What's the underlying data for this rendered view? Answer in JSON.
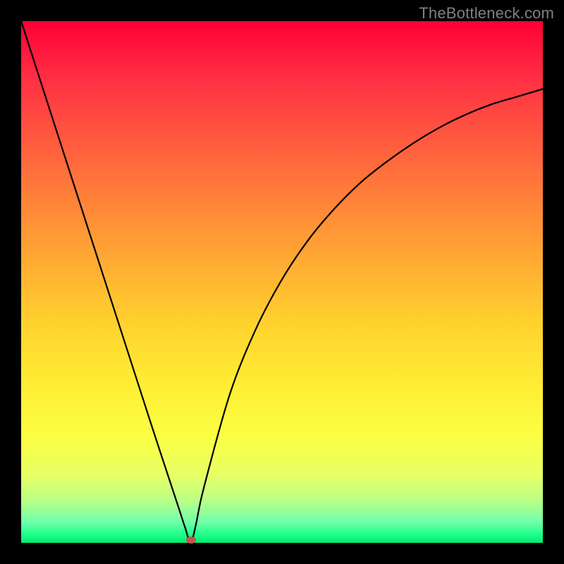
{
  "watermark_text": "TheBottleneck.com",
  "marker": {
    "x_frac": 0.325,
    "y_frac": 0.995,
    "color": "#cc4f4f"
  },
  "chart_data": {
    "type": "line",
    "title": "",
    "xlabel": "",
    "ylabel": "",
    "xlim": [
      0,
      1
    ],
    "ylim": [
      0,
      1
    ],
    "series": [
      {
        "name": "curve",
        "x": [
          0.0,
          0.05,
          0.1,
          0.15,
          0.2,
          0.25,
          0.3,
          0.315,
          0.325,
          0.335,
          0.35,
          0.4,
          0.45,
          0.5,
          0.55,
          0.6,
          0.65,
          0.7,
          0.75,
          0.8,
          0.85,
          0.9,
          0.95,
          1.0
        ],
        "y": [
          1.0,
          0.845,
          0.69,
          0.535,
          0.38,
          0.225,
          0.073,
          0.027,
          0.0,
          0.035,
          0.105,
          0.285,
          0.41,
          0.505,
          0.58,
          0.64,
          0.69,
          0.73,
          0.765,
          0.795,
          0.82,
          0.84,
          0.855,
          0.87
        ]
      }
    ],
    "gradient_stops": [
      {
        "pos": 0.0,
        "color": "#ff0033"
      },
      {
        "pos": 0.2,
        "color": "#ff5040"
      },
      {
        "pos": 0.45,
        "color": "#ffa733"
      },
      {
        "pos": 0.7,
        "color": "#ffee33"
      },
      {
        "pos": 0.92,
        "color": "#b8ff88"
      },
      {
        "pos": 1.0,
        "color": "#00e96f"
      }
    ],
    "annotations": []
  }
}
